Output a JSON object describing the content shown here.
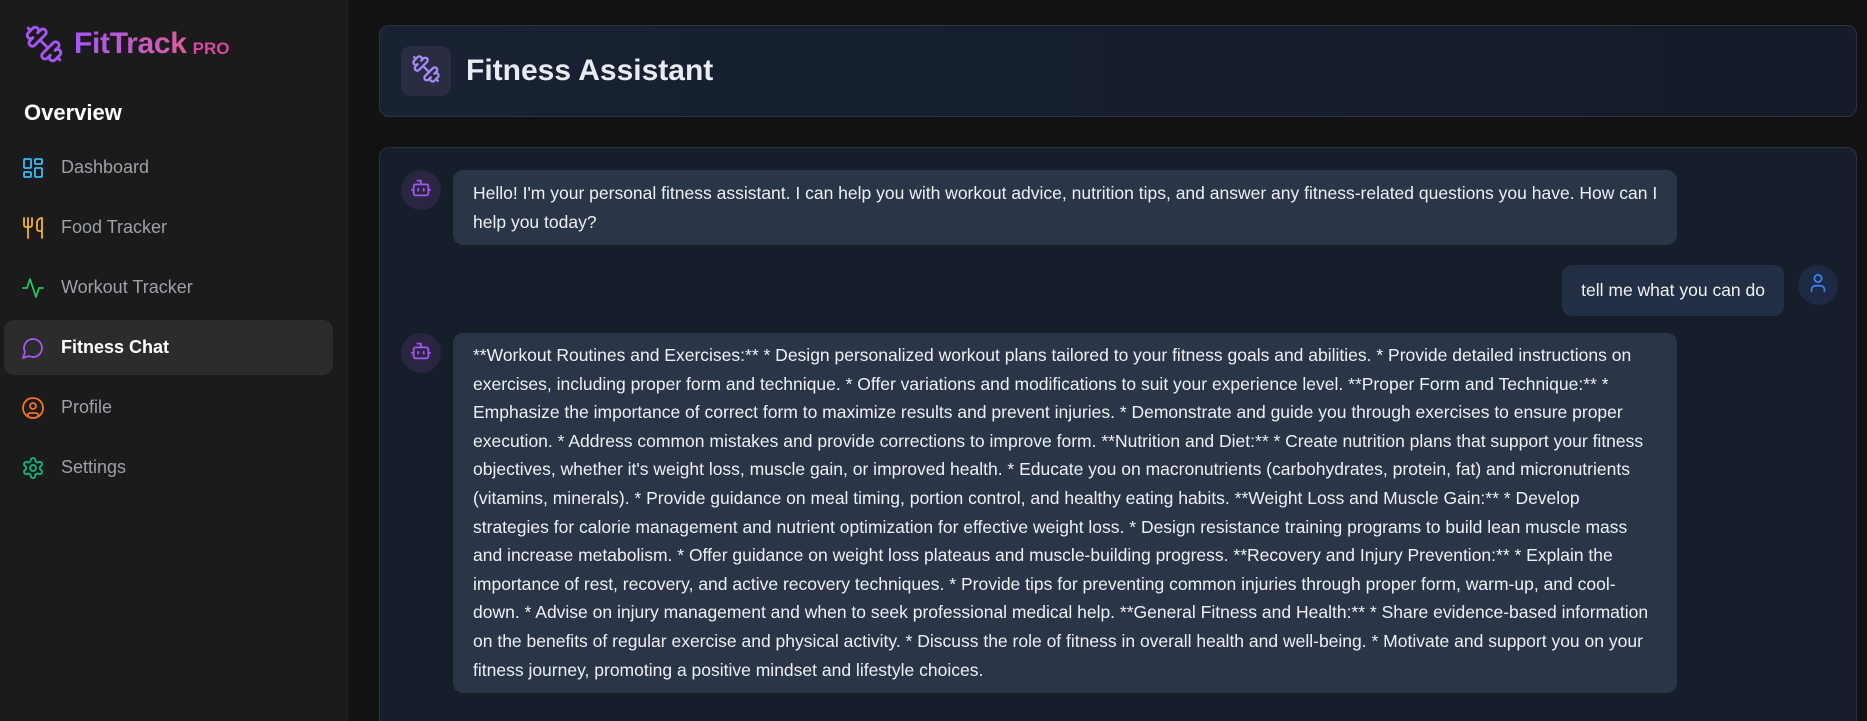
{
  "brand": {
    "name": "FitTrack",
    "badge": "PRO"
  },
  "sidebar": {
    "section_title": "Overview",
    "items": [
      {
        "label": "Dashboard",
        "icon": "dashboard-icon",
        "color": "#38bdf8"
      },
      {
        "label": "Food Tracker",
        "icon": "utensils-icon",
        "color": "#f5b324"
      },
      {
        "label": "Workout Tracker",
        "icon": "activity-icon",
        "color": "#22c55e"
      },
      {
        "label": "Fitness Chat",
        "icon": "chat-bubble-icon",
        "color": "#a855f7",
        "active": true
      },
      {
        "label": "Profile",
        "icon": "user-circle-icon",
        "color": "#f97316"
      },
      {
        "label": "Settings",
        "icon": "gear-icon",
        "color": "#10b981"
      }
    ]
  },
  "header": {
    "title": "Fitness Assistant",
    "icon": "dumbbell-icon"
  },
  "chat": {
    "messages": [
      {
        "role": "assistant",
        "text": "Hello! I'm your personal fitness assistant. I can help you with workout advice, nutrition tips, and answer any fitness-related questions you have. How can I help you today?"
      },
      {
        "role": "user",
        "text": "tell me what you can do"
      },
      {
        "role": "assistant",
        "text": "**Workout Routines and Exercises:** * Design personalized workout plans tailored to your fitness goals and abilities. * Provide detailed instructions on exercises, including proper form and technique. * Offer variations and modifications to suit your experience level. **Proper Form and Technique:** * Emphasize the importance of correct form to maximize results and prevent injuries. * Demonstrate and guide you through exercises to ensure proper execution. * Address common mistakes and provide corrections to improve form. **Nutrition and Diet:** * Create nutrition plans that support your fitness objectives, whether it's weight loss, muscle gain, or improved health. * Educate you on macronutrients (carbohydrates, protein, fat) and micronutrients (vitamins, minerals). * Provide guidance on meal timing, portion control, and healthy eating habits. **Weight Loss and Muscle Gain:** * Develop strategies for calorie management and nutrient optimization for effective weight loss. * Design resistance training programs to build lean muscle mass and increase metabolism. * Offer guidance on weight loss plateaus and muscle-building progress. **Recovery and Injury Prevention:** * Explain the importance of rest, recovery, and active recovery techniques. * Provide tips for preventing common injuries through proper form, warm-up, and cool-down. * Advise on injury management and when to seek professional medical help. **General Fitness and Health:** * Share evidence-based information on the benefits of regular exercise and physical activity. * Discuss the role of fitness in overall health and well-being. * Motivate and support you on your fitness journey, promoting a positive mindset and lifestyle choices."
      }
    ]
  },
  "colors": {
    "accent": "#a855f7",
    "brand_pink": "#d946a6",
    "user_icon": "#3b82f6"
  }
}
